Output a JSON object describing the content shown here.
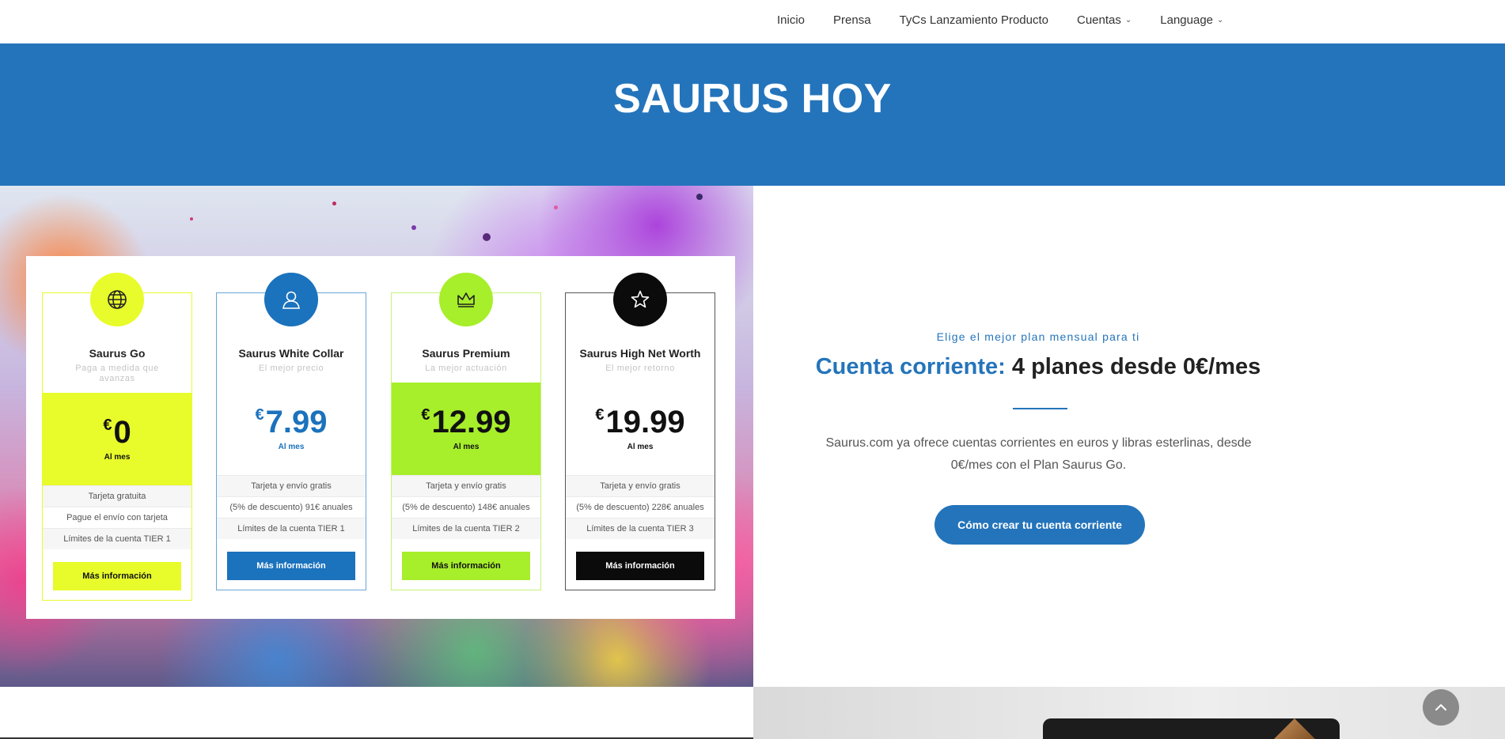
{
  "nav": {
    "items": [
      {
        "label": "Inicio",
        "dropdown": false
      },
      {
        "label": "Prensa",
        "dropdown": false
      },
      {
        "label": "TyCs Lanzamiento Producto",
        "dropdown": false
      },
      {
        "label": "Cuentas",
        "dropdown": true
      },
      {
        "label": "Language",
        "dropdown": true
      }
    ],
    "dropdown_glyph": "⌄"
  },
  "hero": {
    "title": "SAURUS HOY",
    "background": "#2474bb"
  },
  "plans": [
    {
      "name": "Saurus Go",
      "subtitle": "Paga a medida que avanzas",
      "currency": "€",
      "price": "0",
      "period": "Al mes",
      "icon": "globe-icon",
      "accent": "#e8fb2b",
      "features": [
        "Tarjeta gratuita",
        "Pague el envío con tarjeta",
        "Límites de la cuenta TIER 1"
      ],
      "button": "Más información"
    },
    {
      "name": "Saurus White Collar",
      "subtitle": "El mejor precio",
      "currency": "€",
      "price": "7.99",
      "period": "Al mes",
      "icon": "user-icon",
      "accent": "#1b72bd",
      "features": [
        "Tarjeta y envío gratis",
        "(5% de descuento) 91€ anuales",
        "Límites de la cuenta TIER 1"
      ],
      "button": "Más información"
    },
    {
      "name": "Saurus Premium",
      "subtitle": "La mejor actuación",
      "currency": "€",
      "price": "12.99",
      "period": "Al mes",
      "icon": "crown-icon",
      "accent": "#a7ee2b",
      "features": [
        "Tarjeta y envío gratis",
        "(5% de descuento) 148€ anuales",
        "Límites de la cuenta TIER 2"
      ],
      "button": "Más información"
    },
    {
      "name": "Saurus High Net Worth",
      "subtitle": "El mejor retorno",
      "currency": "€",
      "price": "19.99",
      "period": "Al mes",
      "icon": "star-icon",
      "accent": "#0b0b0b",
      "features": [
        "Tarjeta y envío gratis",
        "(5% de descuento) 228€ anuales",
        "Límites de la cuenta TIER 3"
      ],
      "button": "Más información"
    }
  ],
  "intro": {
    "eyebrow": "Elige el mejor plan mensual para ti",
    "headline_highlight": "Cuenta corriente:",
    "headline_rest": "4 planes desde 0€/mes",
    "description": "Saurus.com ya ofrece cuentas corrientes en euros y libras esterlinas, desde 0€/mes con el Plan Saurus Go.",
    "cta": "Cómo crear tu cuenta corriente",
    "accent": "#2474bb"
  },
  "scroll_top": {
    "icon": "chevron-up-icon"
  }
}
